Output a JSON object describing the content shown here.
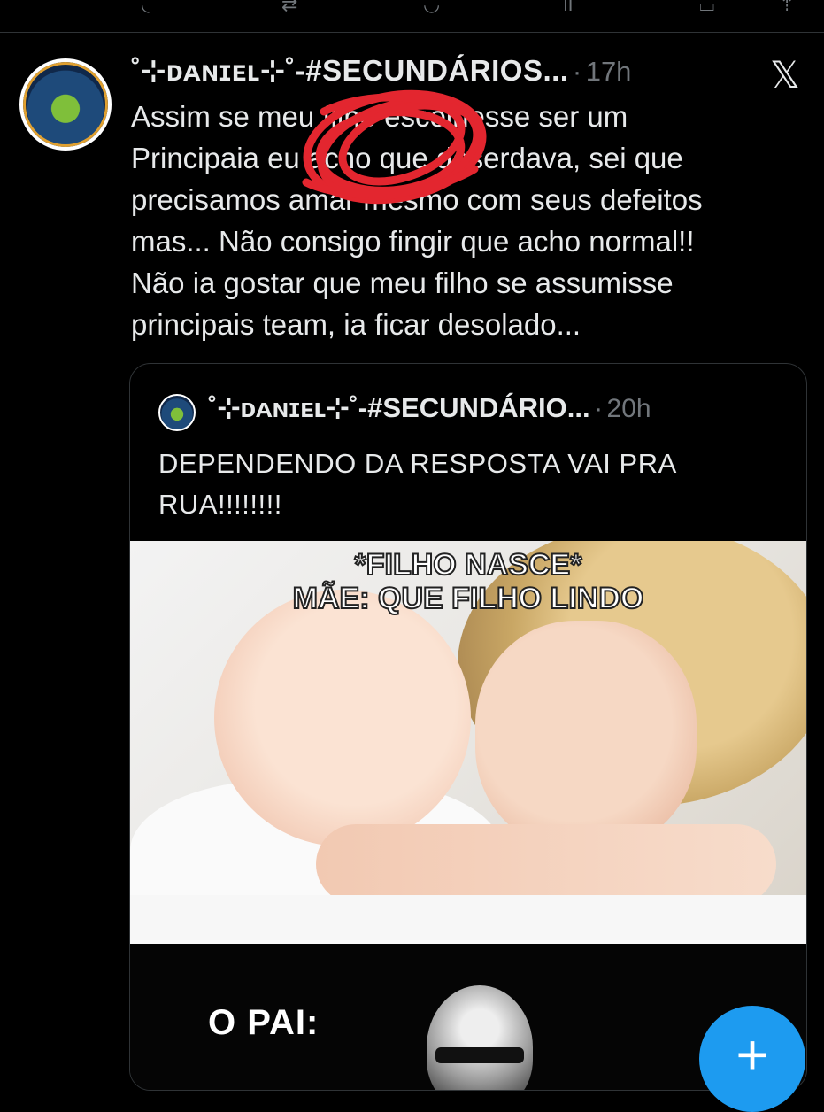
{
  "tweet": {
    "author_name": "˚⊹ᴅᴀɴɪᴇʟ⊹˚-#SECUNDÁRIOS...",
    "separator": "·",
    "time": "17h",
    "lines": [
      "Assim se meu filho escolhesse ser um",
      "Principaia eu acho que deserdava, sei que",
      "precisamos amar mesmo com seus defeitos",
      "mas... Não consigo fingir que acho normal!!",
      "Não ia gostar que meu filho se assumisse",
      "principais team, ia ficar desolado..."
    ]
  },
  "quote": {
    "author_name": "˚⊹ᴅᴀɴɪᴇʟ⊹˚-#SECUNDÁRIO...",
    "separator": "·",
    "time": "20h",
    "lines": [
      "DEPENDENDO DA RESPOSTA VAI PRA",
      "RUA!!!!!!!!"
    ]
  },
  "meme": {
    "caption_line1": "*FILHO NASCE*",
    "caption_line2": "MÃE: QUE FILHO LINDO",
    "bottom_caption": "O PAI:"
  },
  "icons": {
    "platform": "x-logo-icon",
    "compose": "plus-icon"
  },
  "colors": {
    "background": "#000000",
    "text": "#e7e9ea",
    "muted": "#71767b",
    "accent": "#1d9bf0",
    "annotation": "#e3262f"
  },
  "fab": {
    "symbol": "+"
  }
}
